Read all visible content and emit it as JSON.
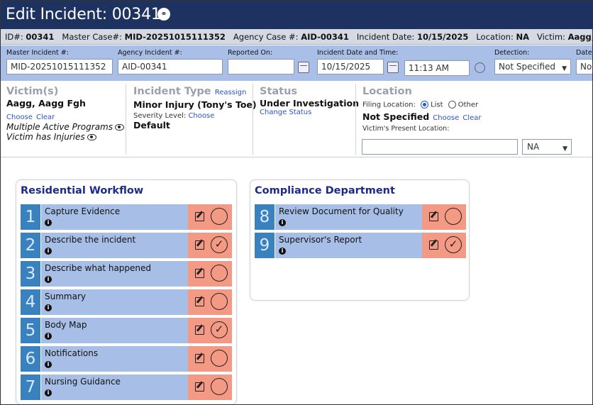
{
  "title": "Edit Incident: 00341",
  "idbar": {
    "id_label": "ID#:",
    "id_value": "00341",
    "master_label": "Master Case#:",
    "master_value": "MID-20251015111352",
    "agency_label": "Agency Case #:",
    "agency_value": "AID-00341",
    "date_label": "Incident Date:",
    "date_value": "10/15/2025",
    "location_label": "Location:",
    "location_value": "NA",
    "victim_label": "Victim:",
    "victim_value": "Aagg, Aagg F"
  },
  "fields": {
    "master_incident_label": "Master Incident #:",
    "master_incident_value": "MID-20251015111352",
    "agency_incident_label": "Agency Incident #:",
    "agency_incident_value": "AID-00341",
    "reported_on_label": "Reported On:",
    "reported_on_value": "",
    "incident_datetime_label": "Incident Date and Time:",
    "incident_date_value": "10/15/2025",
    "incident_time_value": "11:13 AM",
    "detection_label": "Detection:",
    "detection_value": "Not Specified",
    "date_label": "Date",
    "date_value": "No"
  },
  "victims": {
    "heading": "Victim(s)",
    "name": "Aagg, Aagg Fgh",
    "choose": "Choose",
    "clear": "Clear",
    "flag1": "Multiple Active Programs",
    "flag2": "Victim has Injuries"
  },
  "incident_type": {
    "heading": "Incident Type",
    "reassign": "Reassign",
    "value": "Minor Injury (Tony's Toe)",
    "severity_label": "Severity Level:",
    "severity_choose": "Choose",
    "severity_value": "Default"
  },
  "status": {
    "heading": "Status",
    "value": "Under Investigation",
    "change": "Change Status"
  },
  "location": {
    "heading": "Location",
    "filing_label": "Filing Location:",
    "option_list": "List",
    "option_other": "Other",
    "value": "Not Specified",
    "choose": "Choose",
    "clear": "Clear",
    "present_label": "Victim's Present Location:",
    "present_value": "",
    "present_select": "NA"
  },
  "residential": {
    "heading": "Residential Workflow",
    "steps": [
      {
        "num": "1",
        "label": "Capture Evidence",
        "done": false
      },
      {
        "num": "2",
        "label": "Describe the incident",
        "done": true
      },
      {
        "num": "3",
        "label": "Describe what happened",
        "done": false
      },
      {
        "num": "4",
        "label": "Summary",
        "done": false
      },
      {
        "num": "5",
        "label": "Body Map",
        "done": true
      },
      {
        "num": "6",
        "label": "Notifications",
        "done": false
      },
      {
        "num": "7",
        "label": "Nursing Guidance",
        "done": false
      }
    ]
  },
  "compliance": {
    "heading": "Compliance Department",
    "steps": [
      {
        "num": "8",
        "label": "Review Document for Quality",
        "done": false
      },
      {
        "num": "9",
        "label": "Supervisor's Report",
        "done": true
      }
    ]
  },
  "icons": {
    "info": "i",
    "check": "✓"
  }
}
